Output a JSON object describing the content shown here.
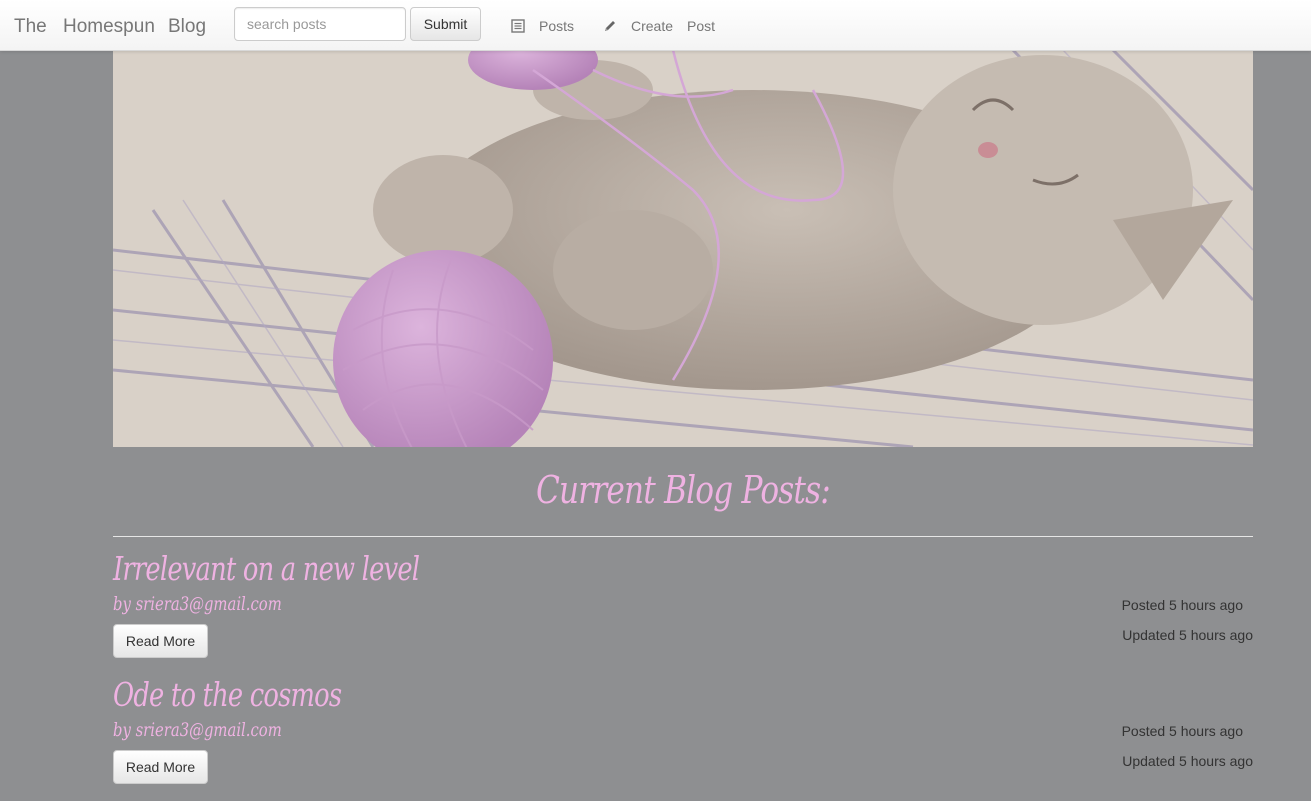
{
  "navbar": {
    "brand_words": [
      "The",
      "Homespun",
      "Blog"
    ],
    "search": {
      "placeholder": "search posts",
      "value": ""
    },
    "submit_label": "Submit",
    "posts_label": "Posts",
    "create_words": [
      "Create",
      "Post"
    ],
    "icons": {
      "posts": "list-icon",
      "create": "pencil-icon"
    }
  },
  "hero": {
    "description_icon": "kitten-photo"
  },
  "section": {
    "title": "Current Blog Posts:"
  },
  "posts": [
    {
      "title": "Irrelevant on a new level",
      "author": "by sriera3@gmail.com",
      "read_more": "Read More",
      "posted": "Posted 5 hours ago",
      "updated": "Updated 5 hours ago"
    },
    {
      "title": "Ode to the cosmos",
      "author": "by sriera3@gmail.com",
      "read_more": "Read More",
      "posted": "Posted 5 hours ago",
      "updated": "Updated 5 hours ago"
    }
  ],
  "colors": {
    "background": "#8e8f91",
    "accent_pink": "#efb2e2",
    "navbar": "#ffffff"
  }
}
